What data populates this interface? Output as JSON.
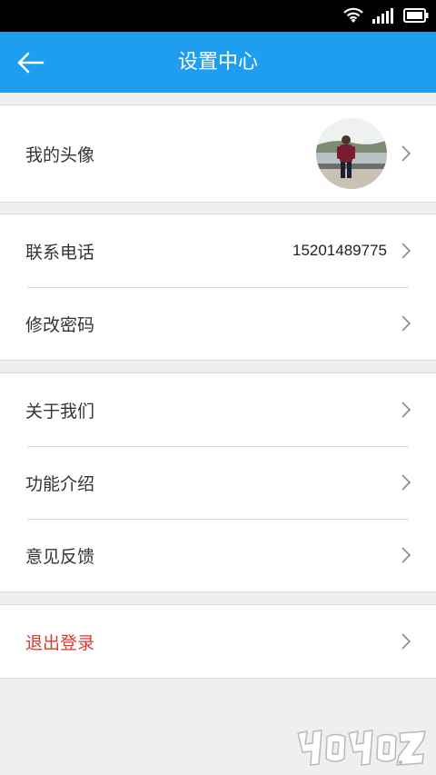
{
  "header": {
    "title": "设置中心"
  },
  "groups": {
    "profile": {
      "avatar_label": "我的头像"
    },
    "account": {
      "phone_label": "联系电话",
      "phone_value": "15201489775",
      "password_label": "修改密码"
    },
    "info": {
      "about_label": "关于我们",
      "features_label": "功能介绍",
      "feedback_label": "意见反馈"
    },
    "session": {
      "logout_label": "退出登录"
    }
  },
  "colors": {
    "app_bar": "#1f9ef0",
    "logout_text": "#dc3a2e",
    "page_background": "#efeff0"
  },
  "icons": {
    "back": "arrow-left-icon",
    "chevron": "chevron-right-icon",
    "wifi": "wifi-icon",
    "signal": "signal-icon",
    "battery": "battery-icon"
  }
}
